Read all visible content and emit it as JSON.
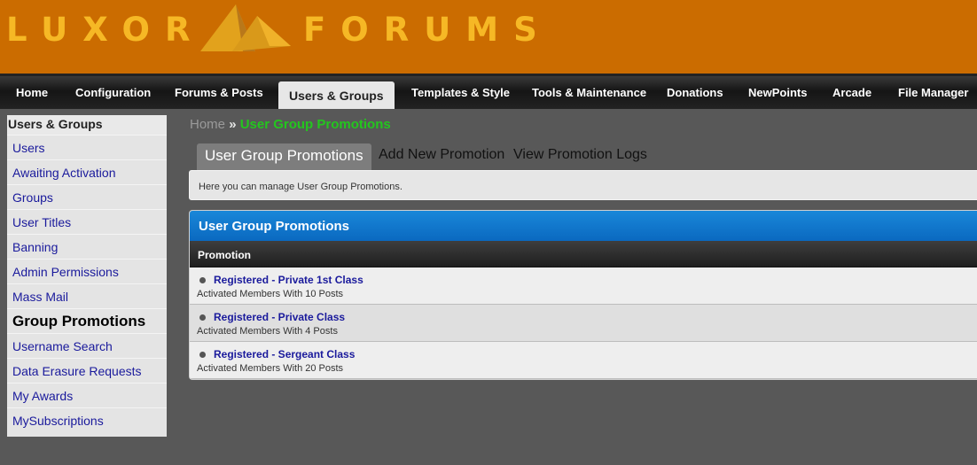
{
  "header": {
    "logo_left": "LUXOR",
    "logo_right": "FORUMS",
    "colors": {
      "background": "#cb6c00",
      "logo_text": "#f6b825",
      "pyramid": "#e2a21c"
    }
  },
  "nav": {
    "tabs": [
      {
        "label": "Home"
      },
      {
        "label": "Configuration"
      },
      {
        "label": "Forums & Posts"
      },
      {
        "label": "Users & Groups",
        "active": true
      },
      {
        "label": "Templates & Style"
      },
      {
        "label": "Tools & Maintenance"
      },
      {
        "label": "Donations"
      },
      {
        "label": "NewPoints"
      },
      {
        "label": "Arcade"
      },
      {
        "label": "File Manager"
      }
    ]
  },
  "sidebar": {
    "title": "Users & Groups",
    "items": [
      {
        "label": "Users"
      },
      {
        "label": "Awaiting Activation"
      },
      {
        "label": "Groups"
      },
      {
        "label": "User Titles"
      },
      {
        "label": "Banning"
      },
      {
        "label": "Admin Permissions"
      },
      {
        "label": "Mass Mail"
      },
      {
        "label": "Group Promotions",
        "active": true
      },
      {
        "label": "Username Search"
      },
      {
        "label": "Data Erasure Requests"
      },
      {
        "label": "My Awards"
      },
      {
        "label": "MySubscriptions"
      }
    ]
  },
  "breadcrumb": {
    "home": "Home",
    "separator": "»",
    "current": "User Group Promotions"
  },
  "subtabs": [
    {
      "label": "User Group Promotions",
      "active": true
    },
    {
      "label": "Add New Promotion"
    },
    {
      "label": "View Promotion Logs"
    }
  ],
  "info": {
    "text": "Here you can manage User Group Promotions."
  },
  "table": {
    "title": "User Group Promotions",
    "column": "Promotion",
    "rows": [
      {
        "title": "Registered - Private 1st Class",
        "description": "Activated Members With 10 Posts"
      },
      {
        "title": "Registered - Private Class",
        "description": "Activated Members With 4 Posts"
      },
      {
        "title": "Registered - Sergeant Class",
        "description": "Activated Members With 20 Posts"
      }
    ],
    "colors": {
      "header": "#0a69c0",
      "link": "#1a1a9c"
    }
  }
}
